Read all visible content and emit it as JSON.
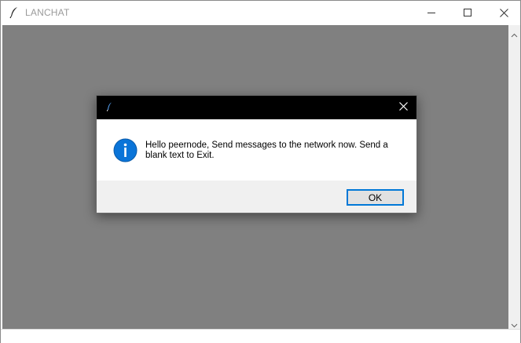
{
  "window": {
    "title": "LANCHAT",
    "icon": "feather-icon",
    "controls": [
      "minimize-icon",
      "maximize-icon",
      "close-icon"
    ]
  },
  "dialog": {
    "icon": "feather-icon",
    "type_icon": "info-icon",
    "message": "Hello peernode, Send messages to the network now. Send a blank text to Exit.",
    "ok_label": "OK",
    "accent_color": "#0078d7"
  },
  "colors": {
    "client_background": "#808080",
    "dialog_titlebar": "#000000",
    "footer_background": "#f0f0f0"
  }
}
